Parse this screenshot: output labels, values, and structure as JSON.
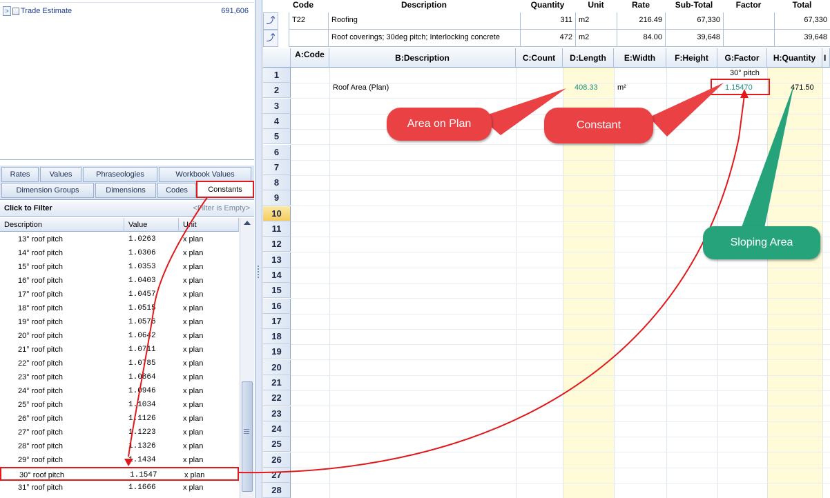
{
  "tree": {
    "rows": [
      {
        "name": "Trade Estimate",
        "value": "691,606"
      }
    ]
  },
  "tabs": {
    "row1": [
      "Rates",
      "Values",
      "Phraseologies",
      "Workbook Values"
    ],
    "row2": [
      "Dimension Groups",
      "Dimensions",
      "Codes",
      "Constants"
    ],
    "active": "Constants"
  },
  "filter": {
    "label": "Click to Filter",
    "note": "<Filter is Empty>"
  },
  "constants": {
    "headers": [
      "Description",
      "Value",
      "Unit"
    ],
    "rows": [
      {
        "desc": "13° roof pitch",
        "value": "1.0263",
        "unit": "x plan"
      },
      {
        "desc": "14° roof pitch",
        "value": "1.0306",
        "unit": "x plan"
      },
      {
        "desc": "15° roof pitch",
        "value": "1.0353",
        "unit": "x plan"
      },
      {
        "desc": "16° roof pitch",
        "value": "1.0403",
        "unit": "x plan"
      },
      {
        "desc": "17° roof pitch",
        "value": "1.0457",
        "unit": "x plan"
      },
      {
        "desc": "18° roof pitch",
        "value": "1.0515",
        "unit": "x plan"
      },
      {
        "desc": "19° roof pitch",
        "value": "1.0576",
        "unit": "x plan"
      },
      {
        "desc": "20° roof pitch",
        "value": "1.0642",
        "unit": "x plan"
      },
      {
        "desc": "21° roof pitch",
        "value": "1.0711",
        "unit": "x plan"
      },
      {
        "desc": "22° roof pitch",
        "value": "1.0785",
        "unit": "x plan"
      },
      {
        "desc": "23° roof pitch",
        "value": "1.0864",
        "unit": "x plan"
      },
      {
        "desc": "24° roof pitch",
        "value": "1.0946",
        "unit": "x plan"
      },
      {
        "desc": "25° roof pitch",
        "value": "1.1034",
        "unit": "x plan"
      },
      {
        "desc": "26° roof pitch",
        "value": "1.1126",
        "unit": "x plan"
      },
      {
        "desc": "27° roof pitch",
        "value": "1.1223",
        "unit": "x plan"
      },
      {
        "desc": "28° roof pitch",
        "value": "1.1326",
        "unit": "x plan"
      },
      {
        "desc": "29° roof pitch",
        "value": "1.1434",
        "unit": "x plan"
      },
      {
        "desc": "30° roof pitch",
        "value": "1.1547",
        "unit": "x plan"
      },
      {
        "desc": "31° roof pitch",
        "value": "1.1666",
        "unit": "x plan"
      }
    ],
    "selected_index": 17
  },
  "estimate": {
    "headers": [
      "Code",
      "Description",
      "Quantity",
      "Unit",
      "Rate",
      "Sub-Total",
      "Factor",
      "Total"
    ],
    "rows": [
      {
        "code": "T22",
        "description": "Roofing",
        "quantity": "311",
        "unit": "m2",
        "rate": "216.49",
        "subtotal": "67,330",
        "factor": "",
        "total": "67,330"
      },
      {
        "code": "",
        "description": "Roof coverings; 30deg pitch; Interlocking concrete",
        "quantity": "472",
        "unit": "m2",
        "rate": "84.00",
        "subtotal": "39,648",
        "factor": "",
        "total": "39,648"
      }
    ]
  },
  "sheet": {
    "columns": [
      "A:Code",
      "B:Description",
      "C:Count",
      "D:Length",
      "E:Width",
      "F:Height",
      "G:Factor",
      "H:Quantity",
      "I"
    ],
    "row_numbers": [
      "1",
      "2",
      "3",
      "4",
      "5",
      "6",
      "7",
      "8",
      "9",
      "10",
      "11",
      "12",
      "13",
      "14",
      "15",
      "16",
      "17",
      "18",
      "19",
      "20",
      "21",
      "22",
      "23",
      "24",
      "25",
      "26",
      "27",
      "28"
    ],
    "current_row": "10",
    "row1_factor_note": "30° pitch",
    "row2": {
      "description": "Roof Area (Plan)",
      "length": "408.33",
      "unit": "m²",
      "factor": "1.15470",
      "quantity": "471.50"
    }
  },
  "callouts": {
    "area": "Area on Plan",
    "constant": "Constant",
    "sloping": "Sloping Area"
  },
  "colors": {
    "accent_red": "#e0191b",
    "callout_red": "#ea4144",
    "callout_green": "#26a37b",
    "highlight_yellow": "#fffbd8",
    "teal_value": "#1b8e86"
  }
}
